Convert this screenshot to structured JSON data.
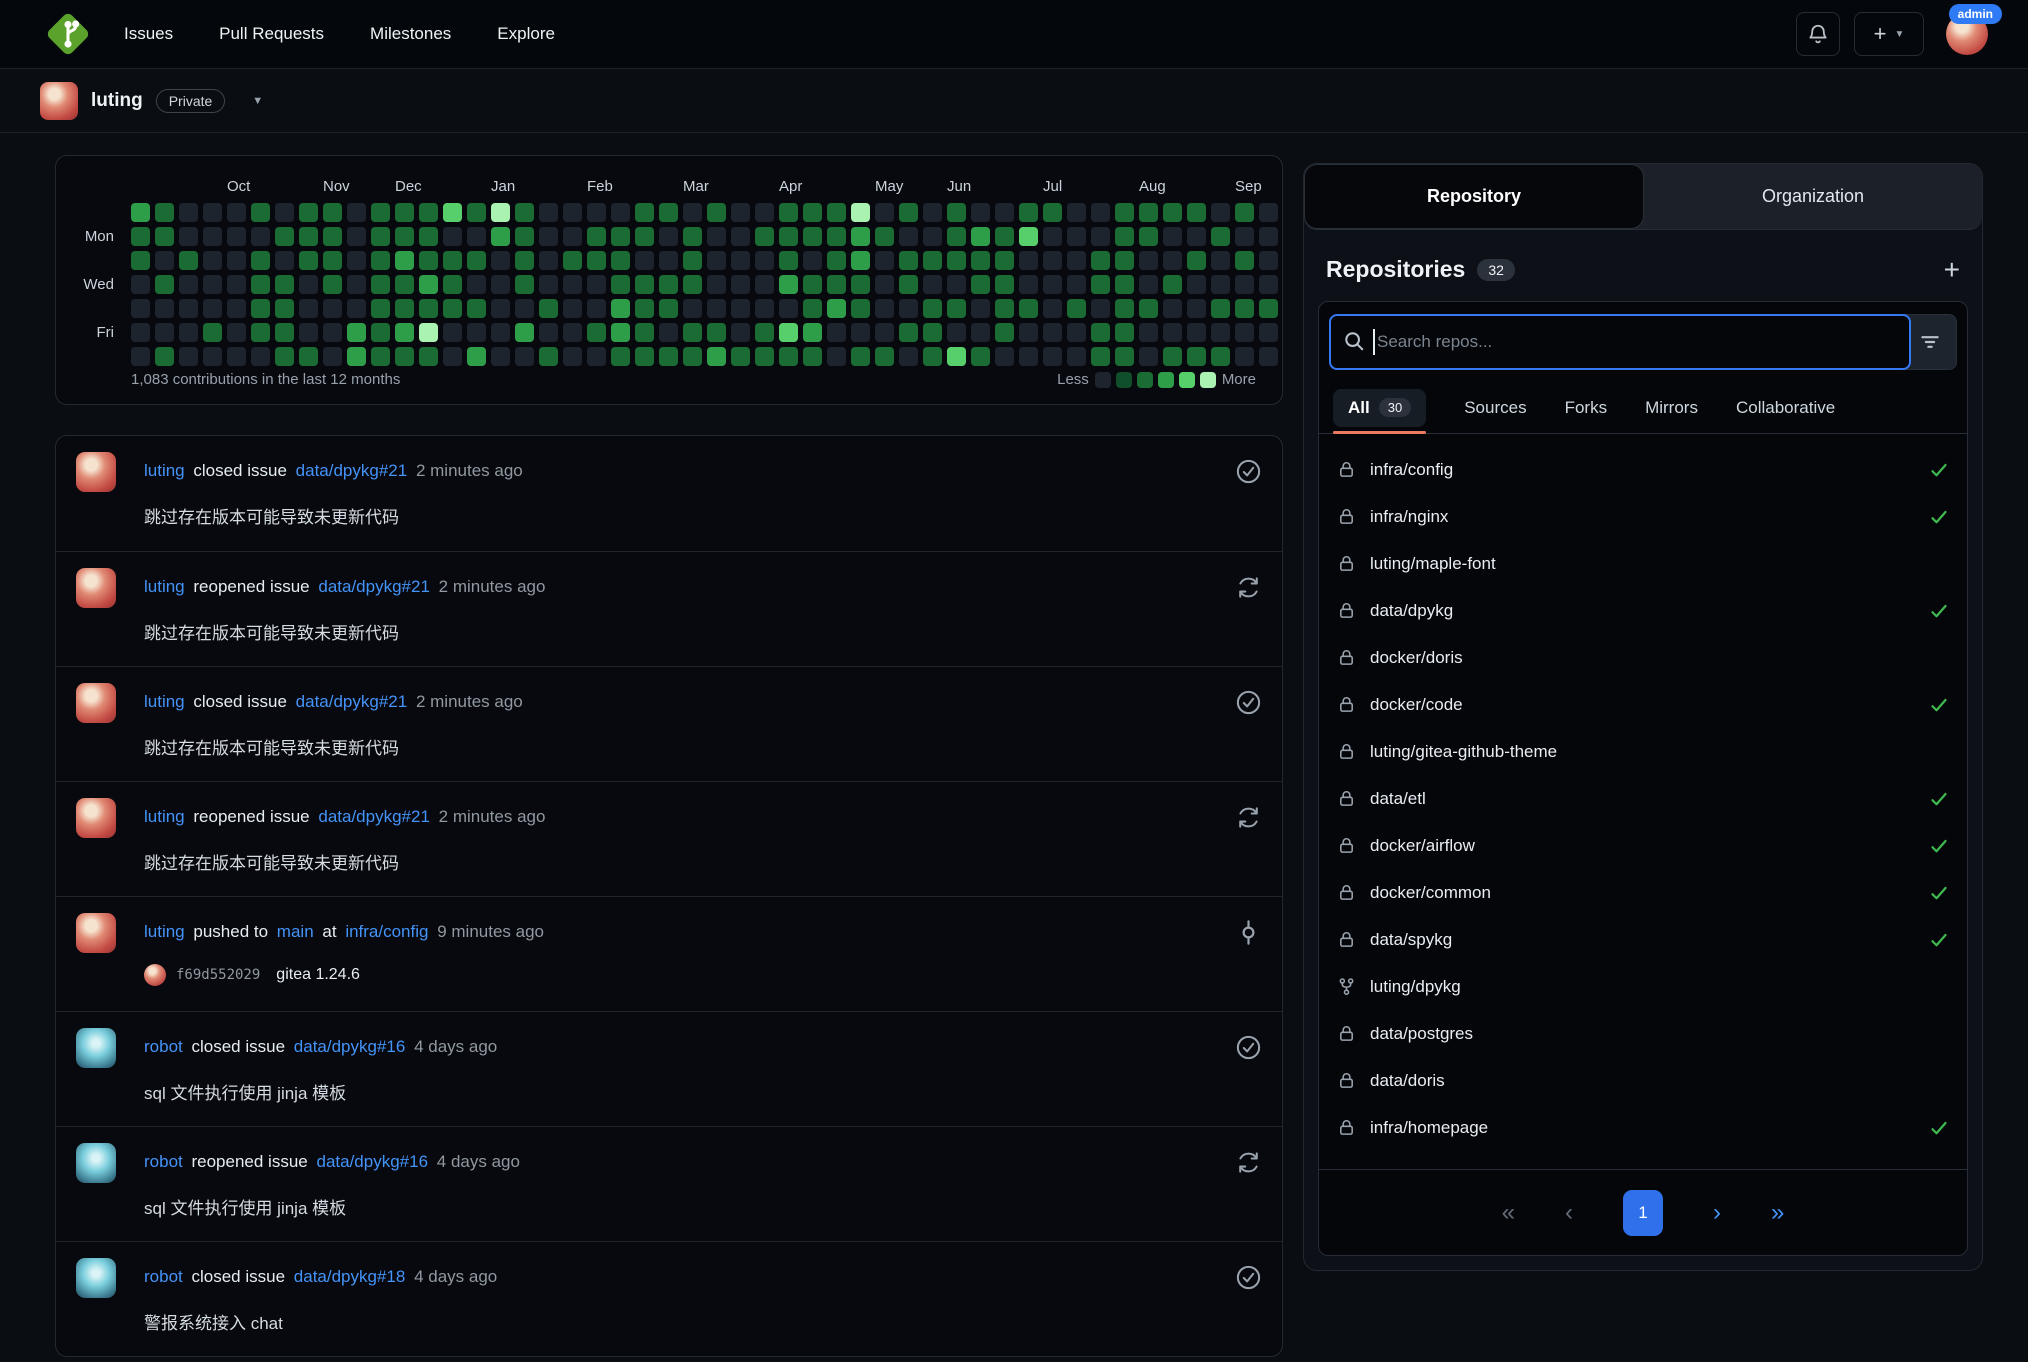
{
  "navbar": {
    "links": [
      "Issues",
      "Pull Requests",
      "Milestones",
      "Explore"
    ],
    "admin_badge": "admin"
  },
  "context": {
    "username": "luting",
    "badge": "Private"
  },
  "heatmap": {
    "type": "heatmap",
    "summary": "1,083 contributions in the last 12 months",
    "legend_less": "Less",
    "legend_more": "More",
    "day_labels": [
      "Mon",
      "Wed",
      "Fri"
    ],
    "months": [
      {
        "label": "Oct",
        "week": 4
      },
      {
        "label": "Nov",
        "week": 8
      },
      {
        "label": "Dec",
        "week": 11
      },
      {
        "label": "Jan",
        "week": 15
      },
      {
        "label": "Feb",
        "week": 19
      },
      {
        "label": "Mar",
        "week": 23
      },
      {
        "label": "Apr",
        "week": 27
      },
      {
        "label": "May",
        "week": 31
      },
      {
        "label": "Jun",
        "week": 34
      },
      {
        "label": "Jul",
        "week": 38
      },
      {
        "label": "Aug",
        "week": 42
      },
      {
        "label": "Sep",
        "week": 46
      }
    ],
    "palette": [
      "#1e242d",
      "#0f4f2b",
      "#1a6b34",
      "#2f9e49",
      "#57cf6a",
      "#a9f2b2"
    ],
    "weeks": [
      "3220000",
      "2202002",
      "0020000",
      "0000020",
      "0000000",
      "2022220",
      "0202222",
      "2220002",
      "2222000",
      "0000033",
      "2222222",
      "2232232",
      "2223252",
      "4022200",
      "2020203",
      "5300000",
      "2222030",
      "0000202",
      "0020000",
      "0220020",
      "0222332",
      "2202222",
      "2002202",
      "0222022",
      "2000023",
      "0000002",
      "0200022",
      "2223042",
      "2202232",
      "2222300",
      "5332202",
      "0200002",
      "2022020",
      "0020222",
      "2220204",
      "0322002",
      "0222220",
      "2400200",
      "2000000",
      "0000200",
      "0022022",
      "2222222",
      "2200200",
      "2002002",
      "2020002",
      "0200202",
      "2020200",
      "0000200"
    ]
  },
  "feed": {
    "items": [
      {
        "user": "luting",
        "avatar": "luting",
        "action": "closed issue",
        "target": "data/dpykg#21",
        "time": "2 minutes ago",
        "body": "跳过存在版本可能导致未更新代码",
        "icon": "issue-closed-icon"
      },
      {
        "user": "luting",
        "avatar": "luting",
        "action": "reopened issue",
        "target": "data/dpykg#21",
        "time": "2 minutes ago",
        "body": "跳过存在版本可能导致未更新代码",
        "icon": "issue-reopened-icon"
      },
      {
        "user": "luting",
        "avatar": "luting",
        "action": "closed issue",
        "target": "data/dpykg#21",
        "time": "2 minutes ago",
        "body": "跳过存在版本可能导致未更新代码",
        "icon": "issue-closed-icon"
      },
      {
        "user": "luting",
        "avatar": "luting",
        "action": "reopened issue",
        "target": "data/dpykg#21",
        "time": "2 minutes ago",
        "body": "跳过存在版本可能导致未更新代码",
        "icon": "issue-reopened-icon"
      },
      {
        "user": "luting",
        "avatar": "luting",
        "action": "pushed to",
        "branch": "main",
        "preposition": "at",
        "target": "infra/config",
        "time": "9 minutes ago",
        "commit_hash": "f69d552029",
        "commit_message": "gitea 1.24.6",
        "icon": "commit-icon"
      },
      {
        "user": "robot",
        "avatar": "robot",
        "action": "closed issue",
        "target": "data/dpykg#16",
        "time": "4 days ago",
        "body": "sql 文件执行使用 jinja 模板",
        "icon": "issue-closed-icon"
      },
      {
        "user": "robot",
        "avatar": "robot",
        "action": "reopened issue",
        "target": "data/dpykg#16",
        "time": "4 days ago",
        "body": "sql 文件执行使用 jinja 模板",
        "icon": "issue-reopened-icon"
      },
      {
        "user": "robot",
        "avatar": "robot",
        "action": "closed issue",
        "target": "data/dpykg#18",
        "time": "4 days ago",
        "body": "警报系统接入 chat",
        "icon": "issue-closed-icon"
      }
    ]
  },
  "sidebar": {
    "tabs": [
      {
        "label": "Repository",
        "active": true
      },
      {
        "label": "Organization",
        "active": false
      }
    ],
    "heading": "Repositories",
    "count": "32",
    "add_label": "+",
    "search_placeholder": "Search repos...",
    "filters": [
      {
        "label": "All",
        "count": "30",
        "active": true
      },
      {
        "label": "Sources",
        "active": false
      },
      {
        "label": "Forks",
        "active": false
      },
      {
        "label": "Mirrors",
        "active": false
      },
      {
        "label": "Collaborative",
        "active": false
      }
    ],
    "repos": [
      {
        "name": "infra/config",
        "icon": "lock-icon",
        "check": true
      },
      {
        "name": "infra/nginx",
        "icon": "lock-icon",
        "check": true
      },
      {
        "name": "luting/maple-font",
        "icon": "lock-icon",
        "check": false
      },
      {
        "name": "data/dpykg",
        "icon": "lock-icon",
        "check": true
      },
      {
        "name": "docker/doris",
        "icon": "lock-icon",
        "check": false
      },
      {
        "name": "docker/code",
        "icon": "lock-icon",
        "check": true
      },
      {
        "name": "luting/gitea-github-theme",
        "icon": "lock-icon",
        "check": false
      },
      {
        "name": "data/etl",
        "icon": "lock-icon",
        "check": true
      },
      {
        "name": "docker/airflow",
        "icon": "lock-icon",
        "check": true
      },
      {
        "name": "docker/common",
        "icon": "lock-icon",
        "check": true
      },
      {
        "name": "data/spykg",
        "icon": "lock-icon",
        "check": true
      },
      {
        "name": "luting/dpykg",
        "icon": "fork-icon",
        "check": false
      },
      {
        "name": "data/postgres",
        "icon": "lock-icon",
        "check": false
      },
      {
        "name": "data/doris",
        "icon": "lock-icon",
        "check": false
      },
      {
        "name": "infra/homepage",
        "icon": "lock-icon",
        "check": true
      }
    ],
    "pagination": {
      "first": "«",
      "prev": "‹",
      "current": "1",
      "next": "›",
      "last": "»"
    }
  },
  "colors": {
    "accent_blue": "#4493f8",
    "green_check": "#3fb950",
    "orange_underline": "#ee7a62",
    "pagination_blue": "#3070ea",
    "admin_badge_blue": "#2f7bf5",
    "gitea_green": "#5aa22c"
  }
}
